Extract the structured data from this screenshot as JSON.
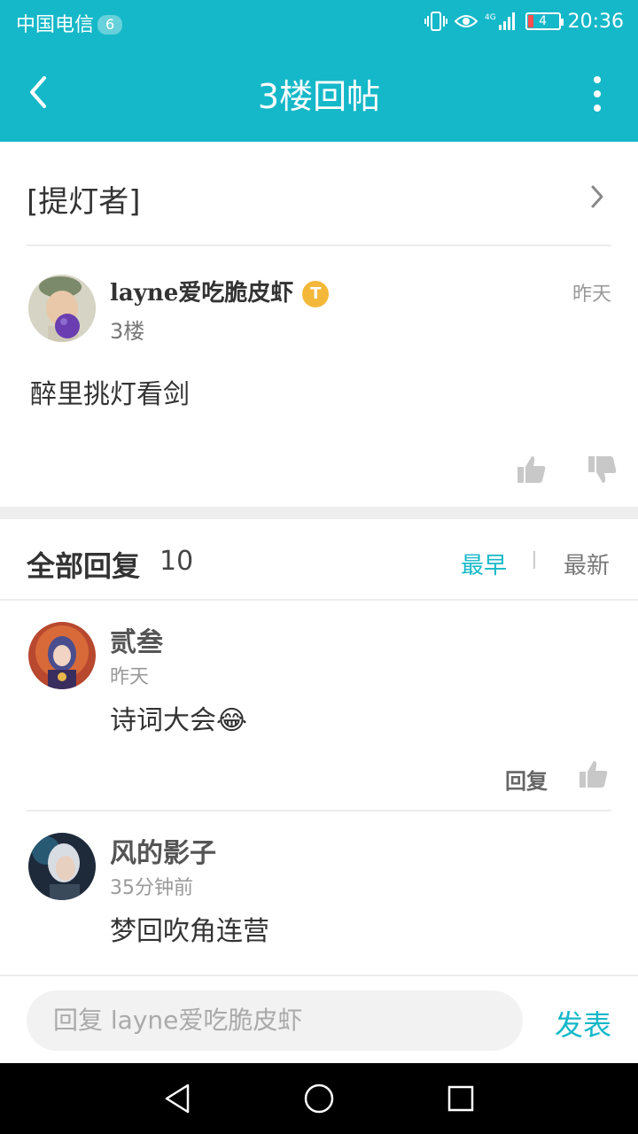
{
  "status_bar": {
    "carrier": "中国电信",
    "carrier_badge": "6",
    "network": "4G",
    "battery": "4",
    "time": "20:36"
  },
  "app_bar": {
    "title": "3楼回帖",
    "back_icon": "chevron-left-icon",
    "more_icon": "more-vertical-icon",
    "color": "#15b8c8"
  },
  "topic": {
    "name": "[提灯者]"
  },
  "post": {
    "author": "layne爱吃脆皮虾",
    "badge": "T",
    "time": "昨天",
    "floor": "3楼",
    "content": "醉里挑灯看剑"
  },
  "replies": {
    "title": "全部回复",
    "count": "10",
    "sort_earliest": "最早",
    "sort_latest": "最新",
    "items": [
      {
        "author": "贰叁",
        "time": "昨天",
        "content": "诗词大会😂",
        "reply_label": "回复"
      },
      {
        "author": "风的影子",
        "time": "35分钟前",
        "content": "梦回吹角连营"
      }
    ]
  },
  "composer": {
    "placeholder": "回复 layne爱吃脆皮虾",
    "send_label": "发表"
  },
  "colors": {
    "accent": "#15b8c8",
    "badge": "#f3b83a"
  }
}
